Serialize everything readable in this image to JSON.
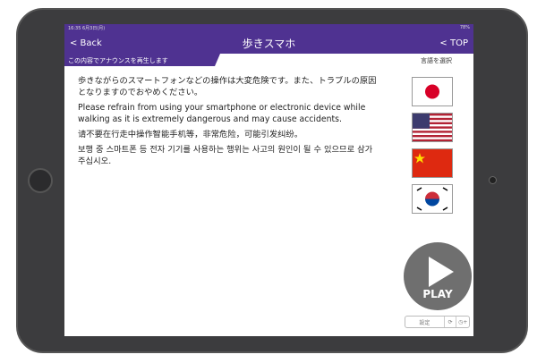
{
  "status": {
    "time": "16:35  6月3日(月)",
    "battery": "78%"
  },
  "nav": {
    "back": "< Back",
    "title": "歩きスマホ",
    "top": "< TOP"
  },
  "banner": {
    "announce": "この内容でアナウンスを再生します",
    "select_language": "言語を選択"
  },
  "messages": {
    "ja": "歩きながらのスマートフォンなどの操作は大変危険です。また、トラブルの原因となりますのでおやめください。",
    "en": "Please refrain from using your smartphone or electronic device while walking as it is extremely dangerous and may cause accidents.",
    "zh": "请不要在行走中操作智能手机等，非常危险，可能引发纠纷。",
    "ko": "보행 중 스마트폰 등 전자 기기를 사용하는 행위는 사고의 원인이 될 수 있으므로 삼가 주십시오."
  },
  "flags": [
    "japan-flag",
    "usa-flag",
    "china-flag",
    "korea-flag"
  ],
  "play": {
    "label": "PLAY"
  },
  "controls": {
    "settings": "設定",
    "repeat": "⟳",
    "timer": "◷+"
  }
}
